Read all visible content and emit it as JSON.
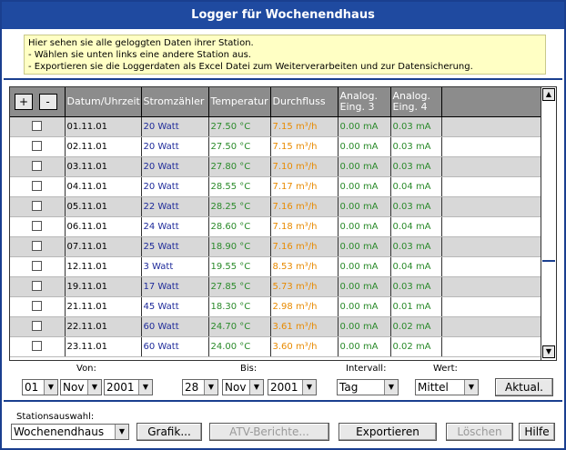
{
  "title": "Logger für Wochenendhaus",
  "info_lines": [
    "Hier sehen sie alle geloggten Daten ihrer Station.",
    "- Wählen sie unten links eine andere Station aus.",
    "- Exportieren sie die Loggerdaten als Excel Datei zum Weiterverarbeiten und zur Datensicherung."
  ],
  "table": {
    "plus": "+",
    "minus": "-",
    "headers": [
      "Datum/Uhrzeit",
      "Stromzähler",
      "Temperatur",
      "Durchfluss",
      "Analog. Eing. 3",
      "Analog. Eing. 4"
    ],
    "rows": [
      [
        "01.11.01",
        "20 Watt",
        "27.50 °C",
        "7.15 m³/h",
        "0.00 mA",
        "0.03 mA"
      ],
      [
        "02.11.01",
        "20 Watt",
        "27.50 °C",
        "7.15 m³/h",
        "0.00 mA",
        "0.03 mA"
      ],
      [
        "03.11.01",
        "20 Watt",
        "27.80 °C",
        "7.10 m³/h",
        "0.00 mA",
        "0.03 mA"
      ],
      [
        "04.11.01",
        "20 Watt",
        "28.55 °C",
        "7.17 m³/h",
        "0.00 mA",
        "0.04 mA"
      ],
      [
        "05.11.01",
        "22 Watt",
        "28.25 °C",
        "7.16 m³/h",
        "0.00 mA",
        "0.03 mA"
      ],
      [
        "06.11.01",
        "24 Watt",
        "28.60 °C",
        "7.18 m³/h",
        "0.00 mA",
        "0.04 mA"
      ],
      [
        "07.11.01",
        "25 Watt",
        "18.90 °C",
        "7.16 m³/h",
        "0.00 mA",
        "0.03 mA"
      ],
      [
        "12.11.01",
        "3 Watt",
        "19.55 °C",
        "8.53 m³/h",
        "0.00 mA",
        "0.04 mA"
      ],
      [
        "19.11.01",
        "17 Watt",
        "27.85 °C",
        "5.73 m³/h",
        "0.00 mA",
        "0.03 mA"
      ],
      [
        "21.11.01",
        "45 Watt",
        "18.30 °C",
        "2.98 m³/h",
        "0.00 mA",
        "0.01 mA"
      ],
      [
        "22.11.01",
        "60 Watt",
        "24.70 °C",
        "3.61 m³/h",
        "0.00 mA",
        "0.02 mA"
      ],
      [
        "23.11.01",
        "60 Watt",
        "24.00 °C",
        "3.60 m³/h",
        "0.00 mA",
        "0.02 mA"
      ]
    ]
  },
  "filters": {
    "von_label": "Von:",
    "von_day": "01",
    "von_month": "Nov",
    "von_year": "2001",
    "bis_label": "Bis:",
    "bis_day": "28",
    "bis_month": "Nov",
    "bis_year": "2001",
    "intervall_label": "Intervall:",
    "intervall": "Tag",
    "wert_label": "Wert:",
    "wert": "Mittel",
    "aktual": "Aktual."
  },
  "bottom": {
    "station_label": "Stationsauswahl:",
    "station": "Wochenendhaus",
    "grafik": "Grafik...",
    "atv": "ATV-Berichte...",
    "export": "Exportieren",
    "loeschen": "Löschen",
    "hilfe": "Hilfe"
  },
  "colors": {
    "title_bg": "#1f4aa0",
    "info_bg": "#ffffc4",
    "header_bg": "#8c8c8c",
    "row_alt": "#d8d8d8",
    "strom": "#1e2a9a",
    "temp": "#2a8a2a",
    "durch": "#e88a00"
  }
}
